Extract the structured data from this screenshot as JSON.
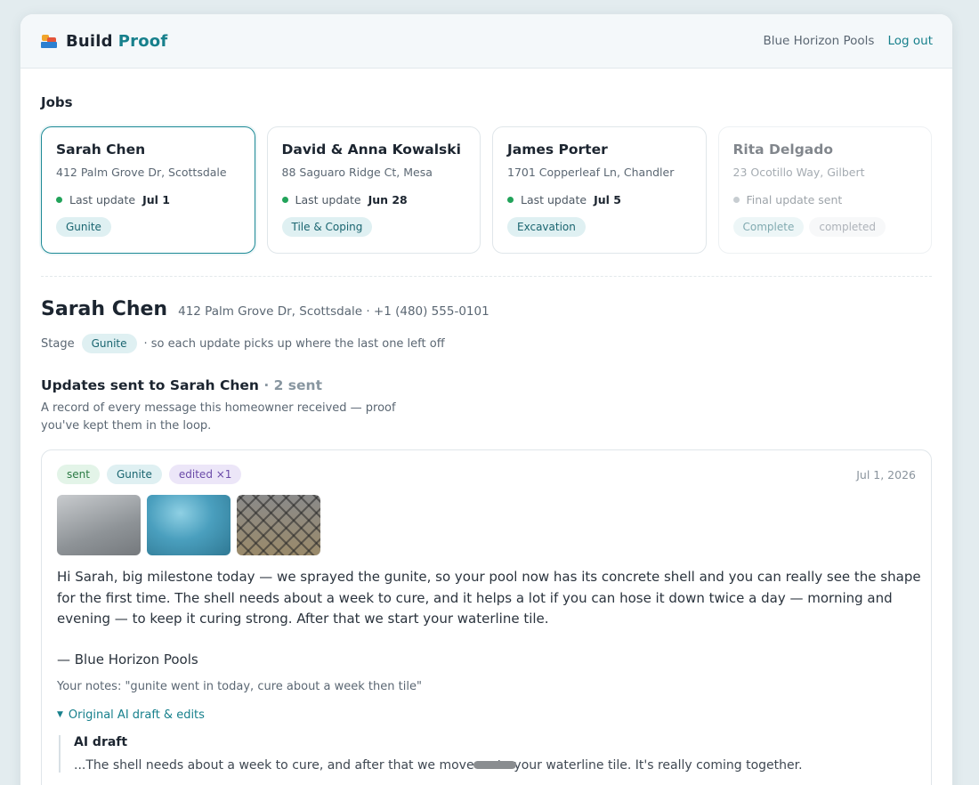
{
  "header": {
    "brand_part1": "Build",
    "brand_part2": "Proof",
    "company": "Blue Horizon Pools",
    "logout_label": "Log out"
  },
  "jobs_title": "Jobs",
  "jobs": [
    {
      "name": "Sarah Chen",
      "address": "412 Palm Grove Dr, Scottsdale",
      "update_label": "Last update",
      "update_date": "Jul 1",
      "stage": "Gunite"
    },
    {
      "name": "David & Anna Kowalski",
      "address": "88 Saguaro Ridge Ct, Mesa",
      "update_label": "Last update",
      "update_date": "Jun 28",
      "stage": "Tile & Coping"
    },
    {
      "name": "James Porter",
      "address": "1701 Copperleaf Ln, Chandler",
      "update_label": "Last update",
      "update_date": "Jul 5",
      "stage": "Excavation"
    },
    {
      "name": "Rita Delgado",
      "address": "23 Ocotillo Way, Gilbert",
      "update_label": "Final update sent",
      "stage": "Complete",
      "status": "completed"
    }
  ],
  "selected": {
    "name": "Sarah Chen",
    "meta": "412 Palm Grove Dr, Scottsdale · +1 (480) 555-0101",
    "stage_label": "Stage",
    "stage": "Gunite",
    "stage_note": "· so each update picks up where the last one left off"
  },
  "updates": {
    "title": "Updates sent to Sarah Chen",
    "count": "· 2 sent",
    "description": "A record of every message this homeowner received — proof you've kept them in the loop."
  },
  "message": {
    "status": "sent",
    "stage": "Gunite",
    "edited": "edited ×1",
    "date": "Jul 1, 2026",
    "body": "Hi Sarah, big milestone today — we sprayed the gunite, so your pool now has its concrete shell and you can really see the shape for the first time. The shell needs about a week to cure, and it helps a lot if you can hose it down twice a day — morning and evening — to keep it curing strong. After that we start your waterline tile.",
    "signature": "— Blue Horizon Pools",
    "notes": "Your notes: \"gunite went in today, cure about a week then tile\"",
    "drafts_toggle": "Original AI draft & edits",
    "draft_title": "AI draft",
    "draft_text": "...The shell needs about a week to cure, and after that we move on to your waterline tile. It's really coming together."
  }
}
